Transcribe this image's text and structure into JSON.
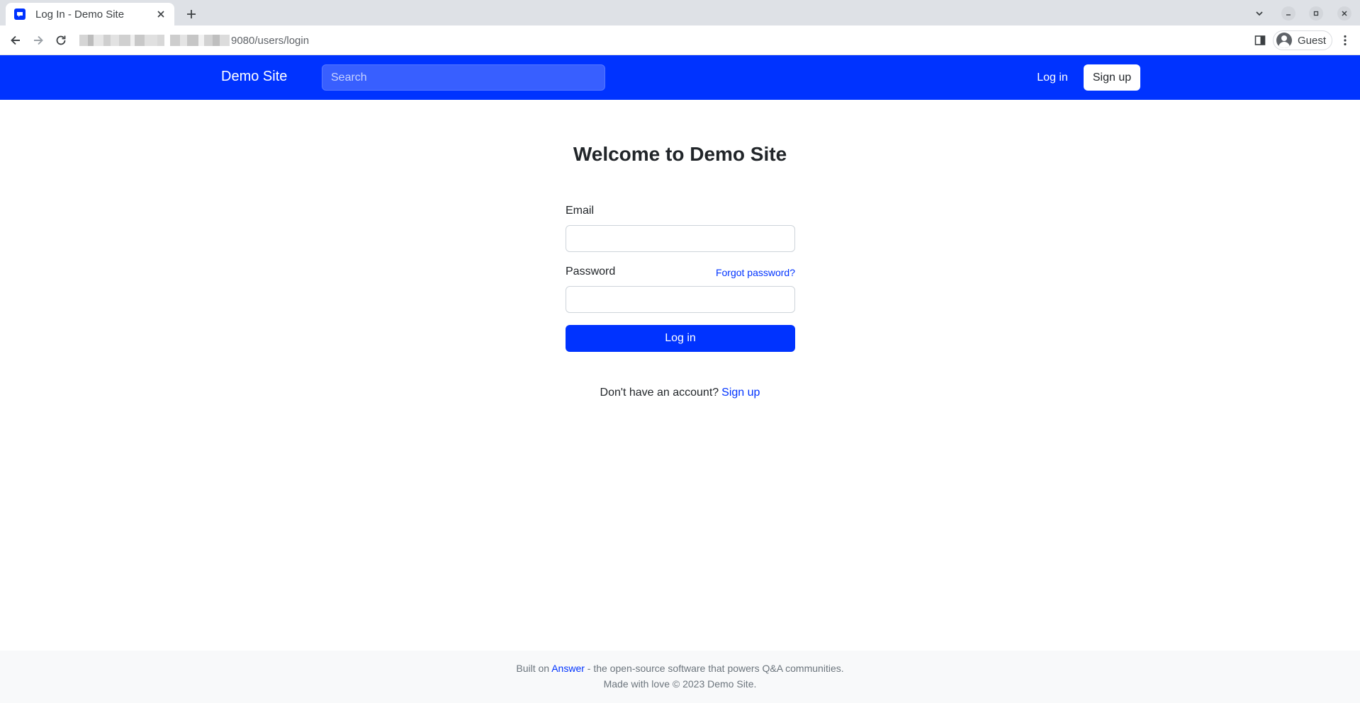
{
  "browser": {
    "tab_title": "Log In - Demo Site",
    "url_visible": "9080/users/login",
    "profile_name": "Guest",
    "icons": {
      "favicon": "chat-bubble-icon",
      "tab_close": "close-icon",
      "new_tab": "plus-icon",
      "tab_search": "chevron-down-icon",
      "minimize": "minimize-icon",
      "maximize": "maximize-icon",
      "close_window": "close-icon",
      "back": "arrow-left-icon",
      "forward": "arrow-right-icon",
      "reload": "reload-icon",
      "side_panel": "side-panel-icon",
      "profile": "avatar-icon",
      "menu": "kebab-menu-icon"
    }
  },
  "header": {
    "brand": "Demo Site",
    "search_placeholder": "Search",
    "login_label": "Log in",
    "signup_label": "Sign up"
  },
  "main": {
    "title": "Welcome to Demo Site",
    "email_label": "Email",
    "email_value": "",
    "password_label": "Password",
    "password_value": "",
    "forgot_label": "Forgot password?",
    "submit_label": "Log in",
    "signup_prompt": "Don't have an account?",
    "signup_link": "Sign up"
  },
  "footer": {
    "built_on": "Built on",
    "answer_link": "Answer",
    "tagline": "- the open-source software that powers Q&A communities.",
    "made_with": "Made with love © 2023 Demo Site."
  },
  "colors": {
    "brand_blue": "#0033ff",
    "tab_strip": "#dee1e6",
    "footer_bg": "#f8f9fa",
    "muted_text": "#6c757d"
  }
}
